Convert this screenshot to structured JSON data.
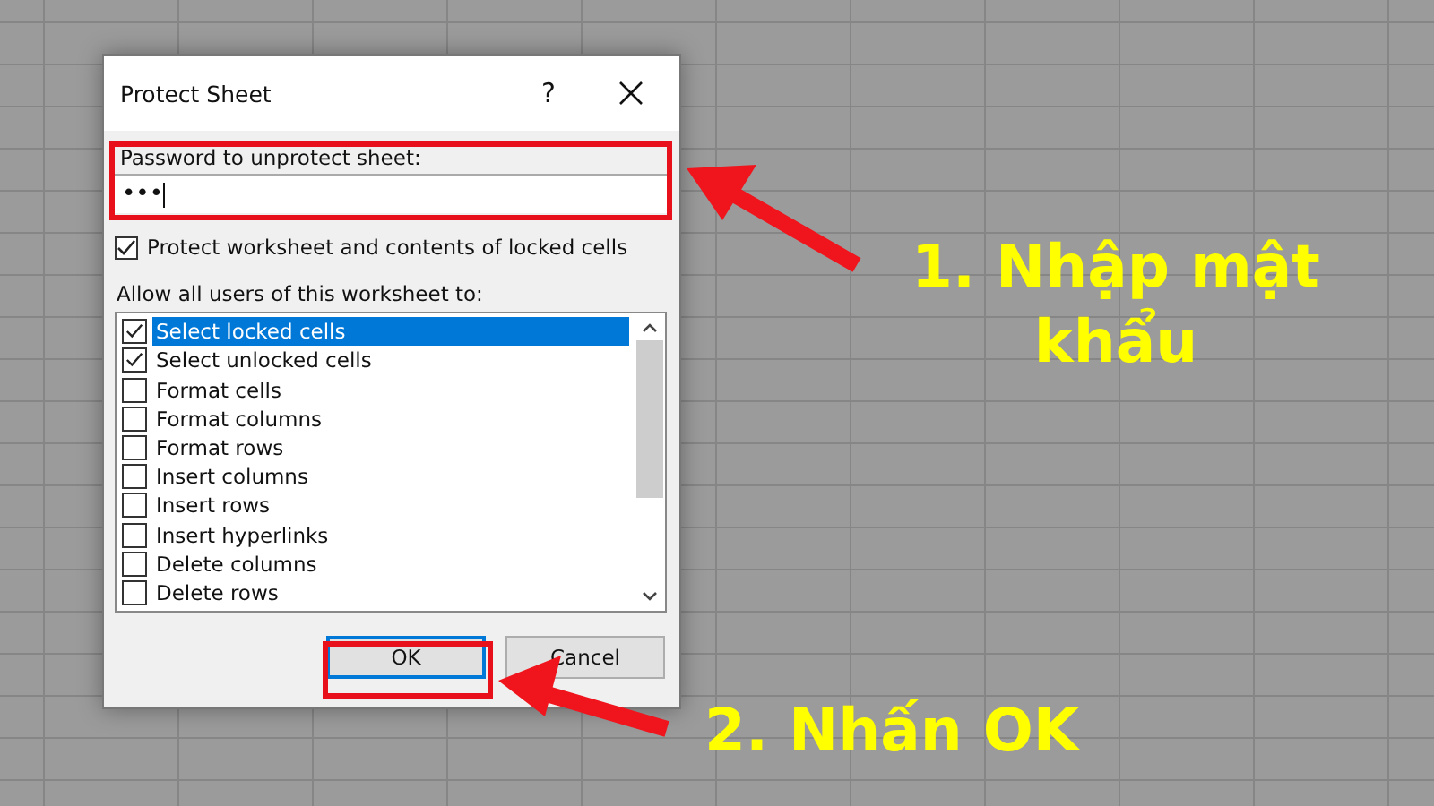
{
  "dialog": {
    "title": "Protect Sheet",
    "help": "?",
    "password": {
      "label": "Password to unprotect sheet:",
      "value": "•••"
    },
    "protect_option": {
      "label": "Protect worksheet and contents of locked cells",
      "checked": true
    },
    "allow_label": "Allow all users of this worksheet to:",
    "permissions": [
      {
        "label": "Select locked cells",
        "checked": true,
        "selected": true
      },
      {
        "label": "Select unlocked cells",
        "checked": true,
        "selected": false
      },
      {
        "label": "Format cells",
        "checked": false,
        "selected": false
      },
      {
        "label": "Format columns",
        "checked": false,
        "selected": false
      },
      {
        "label": "Format rows",
        "checked": false,
        "selected": false
      },
      {
        "label": "Insert columns",
        "checked": false,
        "selected": false
      },
      {
        "label": "Insert rows",
        "checked": false,
        "selected": false
      },
      {
        "label": "Insert hyperlinks",
        "checked": false,
        "selected": false
      },
      {
        "label": "Delete columns",
        "checked": false,
        "selected": false
      },
      {
        "label": "Delete rows",
        "checked": false,
        "selected": false
      }
    ],
    "buttons": [
      {
        "label": "OK",
        "kind": "primary"
      },
      {
        "label": "Cancel",
        "kind": "secondary"
      }
    ]
  },
  "callouts": [
    {
      "text": "1. Nhập mật khẩu"
    },
    {
      "text": "2. Nhấn OK"
    }
  ]
}
